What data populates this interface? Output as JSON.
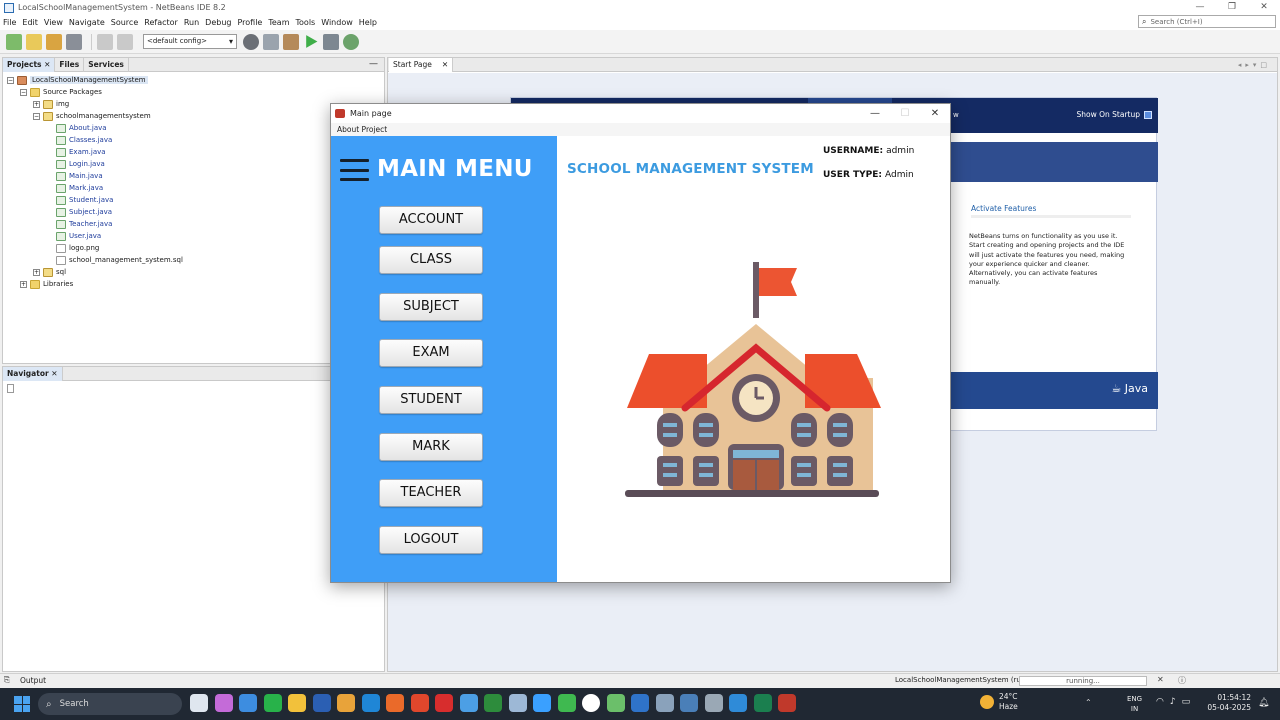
{
  "ide": {
    "window_title": "LocalSchoolManagementSystem - NetBeans IDE 8.2",
    "menu": [
      "File",
      "Edit",
      "View",
      "Navigate",
      "Source",
      "Refactor",
      "Run",
      "Debug",
      "Profile",
      "Team",
      "Tools",
      "Window",
      "Help"
    ],
    "search_placeholder": "Search (Ctrl+I)",
    "config_select": "<default config>",
    "panel_tabs": [
      "Projects",
      "Files",
      "Services"
    ],
    "project_tree": [
      {
        "label": "LocalSchoolManagementSystem",
        "icon": "project-icon",
        "depth": 0
      },
      {
        "label": "Source Packages",
        "icon": "folder-icon",
        "depth": 1
      },
      {
        "label": "img",
        "icon": "package-icon",
        "depth": 2
      },
      {
        "label": "schoolmanagementsystem",
        "icon": "package-icon",
        "depth": 2
      },
      {
        "label": "About.java",
        "icon": "java-file-icon",
        "depth": 3
      },
      {
        "label": "Classes.java",
        "icon": "java-file-icon",
        "depth": 3
      },
      {
        "label": "Exam.java",
        "icon": "java-file-icon",
        "depth": 3
      },
      {
        "label": "Login.java",
        "icon": "java-file-icon",
        "depth": 3
      },
      {
        "label": "Main.java",
        "icon": "java-file-icon",
        "depth": 3
      },
      {
        "label": "Mark.java",
        "icon": "java-file-icon",
        "depth": 3
      },
      {
        "label": "Student.java",
        "icon": "java-file-icon",
        "depth": 3
      },
      {
        "label": "Subject.java",
        "icon": "java-file-icon",
        "depth": 3
      },
      {
        "label": "Teacher.java",
        "icon": "java-file-icon",
        "depth": 3
      },
      {
        "label": "User.java",
        "icon": "java-file-icon",
        "depth": 3
      },
      {
        "label": "logo.png",
        "icon": "image-file-icon",
        "depth": 3
      },
      {
        "label": "school_management_system.sql",
        "icon": "sql-file-icon",
        "depth": 3
      },
      {
        "label": "sql",
        "icon": "package-icon",
        "depth": 2
      },
      {
        "label": "Libraries",
        "icon": "library-icon",
        "depth": 1
      }
    ],
    "navigator_tab": "Navigator",
    "editor_tab": "Start Page",
    "start_page": {
      "show_on_startup": "Show On Startup",
      "features_title": "Activate Features",
      "features_text": "NetBeans turns on functionality as you use it. Start creating and opening projects and the IDE will just activate the features you need, making your experience quicker and cleaner. Alternatively, you can activate features manually.",
      "java_logo": "Java",
      "partial_tab": "w"
    },
    "status": {
      "output_label": "Output",
      "project_run": "LocalSchoolManagementSystem (run)",
      "progress_text": "running..."
    }
  },
  "app": {
    "window_title": "Main page",
    "menu": "About Project",
    "sidebar_title": "MAIN MENU",
    "menu_buttons": [
      "ACCOUNT",
      "CLASS",
      "SUBJECT",
      "EXAM",
      "STUDENT",
      "MARK",
      "TEACHER",
      "LOGOUT"
    ],
    "header_title": "SCHOOL MANAGEMENT SYSTEM",
    "username_label": "USERNAME:",
    "username_value": "admin",
    "usertype_label": "USER TYPE:",
    "usertype_value": "Admin",
    "colors": {
      "sidebar": "#3f9ef7",
      "header_text": "#3c9be0"
    }
  },
  "taskbar": {
    "search_label": "Search",
    "weather_temp": "24°C",
    "weather_desc": "Haze",
    "lang_top": "ENG",
    "lang_bottom": "IN",
    "time": "01:54:12",
    "date": "05-04-2025"
  }
}
